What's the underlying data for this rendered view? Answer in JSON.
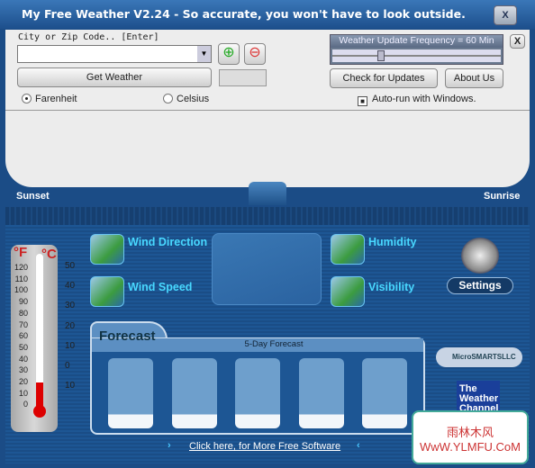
{
  "window": {
    "title": "My Free Weather V2.24 -  So accurate, you won't have to look outside.",
    "close": "X"
  },
  "search": {
    "label": "City or Zip Code..  [Enter]",
    "value": "",
    "get_weather": "Get Weather"
  },
  "units": {
    "fahrenheit": "Farenheit",
    "celsius": "Celsius",
    "selected": "Farenheit"
  },
  "update": {
    "frequency_label": "Weather Update Frequency = 60 Min",
    "close": "X",
    "check_updates": "Check for Updates",
    "about": "About Us",
    "autorun": "Auto-run with Windows.",
    "autorun_checked": true
  },
  "sun": {
    "sunset": "Sunset",
    "sunrise": "Sunrise"
  },
  "thermometer": {
    "f_unit": "°F",
    "c_unit": "°C",
    "f_ticks": [
      "120",
      "110",
      "100",
      "90",
      "80",
      "70",
      "60",
      "50",
      "40",
      "30",
      "20",
      "10",
      "0"
    ],
    "c_ticks": [
      "50",
      "40",
      "30",
      "20",
      "10",
      "0",
      "10"
    ]
  },
  "conditions": {
    "wind_direction": "Wind Direction",
    "wind_speed": "Wind Speed",
    "humidity": "Humidity",
    "visibility": "Visibility"
  },
  "settings": "Settings",
  "forecast": {
    "tab": "Forecast",
    "title": "5-Day Forecast"
  },
  "footer": {
    "link": "Click here, for More Free Software"
  },
  "logos": {
    "microsmarts": "MicroSMARTSLLC",
    "weather_channel": "The Weather Channel",
    "watermark": "雨林木风 WwW.YLMFU.CoM"
  }
}
